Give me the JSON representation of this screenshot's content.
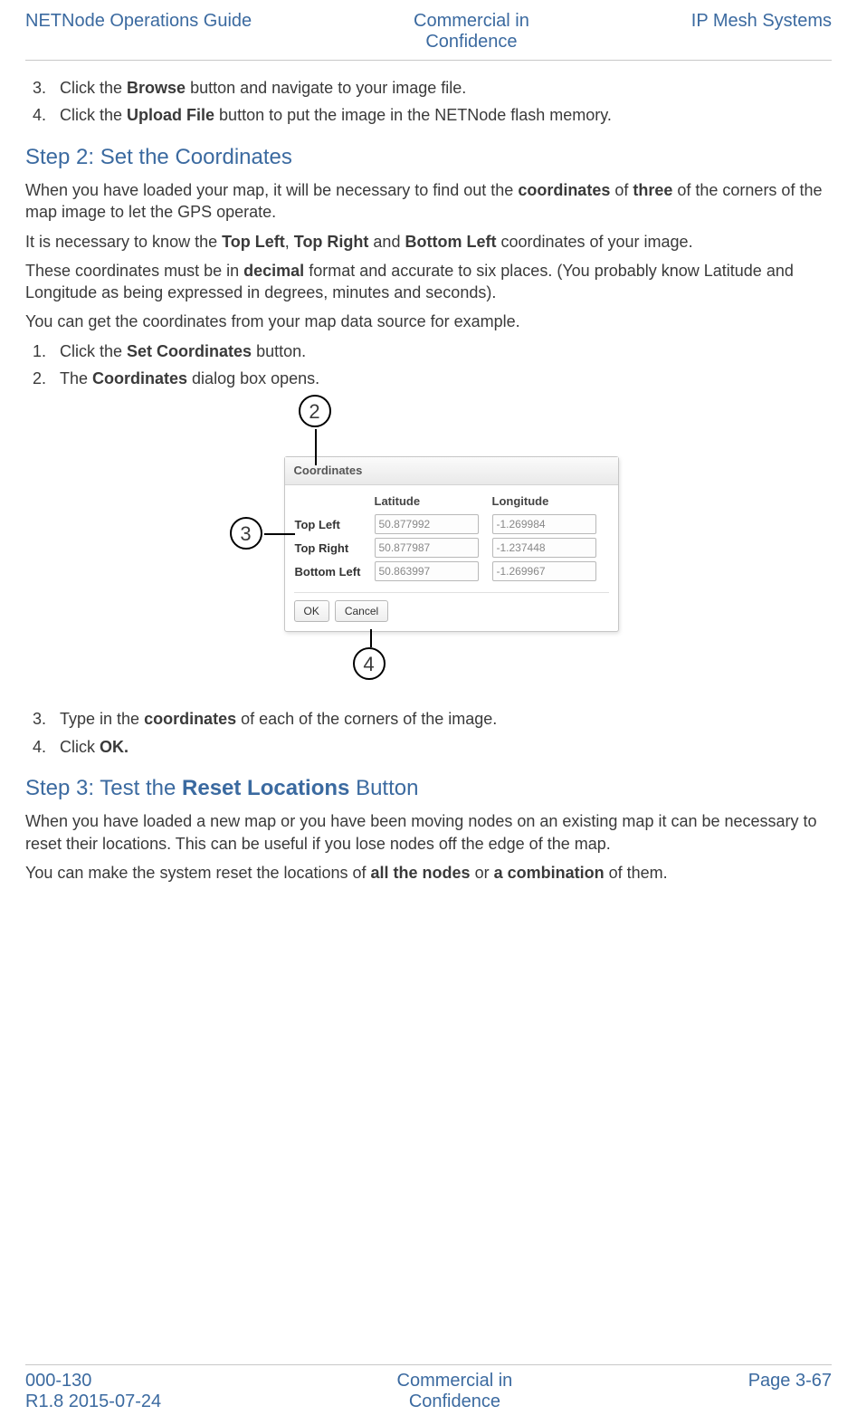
{
  "header": {
    "left": "NETNode Operations Guide",
    "center_l1": "Commercial in",
    "center_l2": "Confidence",
    "right": "IP Mesh Systems"
  },
  "intro_list": {
    "start": 3,
    "li3_a": "Click the ",
    "li3_b": "Browse",
    "li3_c": " button and navigate to your image file.",
    "li4_a": "Click the ",
    "li4_b": "Upload File",
    "li4_c": " button to put the image in the NETNode flash memory."
  },
  "step2": {
    "heading": "Step 2: Set the Coordinates",
    "p1_a": "When you have loaded your map, it will be necessary to find out the ",
    "p1_b": "coordinates",
    "p1_c": " of ",
    "p1_d": "three",
    "p1_e": " of the corners of the map image to let the GPS operate.",
    "p2_a": "It is necessary to know the ",
    "p2_b": "Top Left",
    "p2_c": ", ",
    "p2_d": "Top Right",
    "p2_e": " and ",
    "p2_f": "Bottom Left",
    "p2_g": " coordinates of your image.",
    "p3_a": "These coordinates must be in ",
    "p3_b": "decimal",
    "p3_c": " format and accurate to six places. (You probably know Latitude and Longitude as being expressed in degrees, minutes and seconds).",
    "p4": "You can get the coordinates from your map data source for example.",
    "li1_a": "Click the ",
    "li1_b": "Set Coordinates",
    "li1_c": " button.",
    "li2_a": "The ",
    "li2_b": "Coordinates",
    "li2_c": " dialog box opens.",
    "li3_a": "Type in the ",
    "li3_b": "coordinates",
    "li3_c": " of each of the corners of the image.",
    "li4_a": "Click ",
    "li4_b": "OK."
  },
  "dialog": {
    "title": "Coordinates",
    "col_lat": "Latitude",
    "col_lon": "Longitude",
    "row_tl": "Top Left",
    "row_tr": "Top Right",
    "row_bl": "Bottom Left",
    "tl_lat": "50.877992",
    "tl_lon": "-1.269984",
    "tr_lat": "50.877987",
    "tr_lon": "-1.237448",
    "bl_lat": "50.863997",
    "bl_lon": "-1.269967",
    "ok": "OK",
    "cancel": "Cancel",
    "callout2": "2",
    "callout3": "3",
    "callout4": "4"
  },
  "step3": {
    "heading_a": "Step 3: Test the ",
    "heading_b": "Reset Locations",
    "heading_c": " Button",
    "p1": "When you have loaded a new map or you have been moving nodes on an existing map it can be necessary to reset their locations. This can be useful if you lose nodes off the edge of the map.",
    "p2_a": "You can make the system reset the locations of ",
    "p2_b": "all the nodes",
    "p2_c": " or ",
    "p2_d": "a combination",
    "p2_e": " of them."
  },
  "footer": {
    "left_l1": "000-130",
    "left_l2": "R1.8 2015-07-24",
    "center_l1": "Commercial in",
    "center_l2": "Confidence",
    "right": "Page 3-67"
  }
}
